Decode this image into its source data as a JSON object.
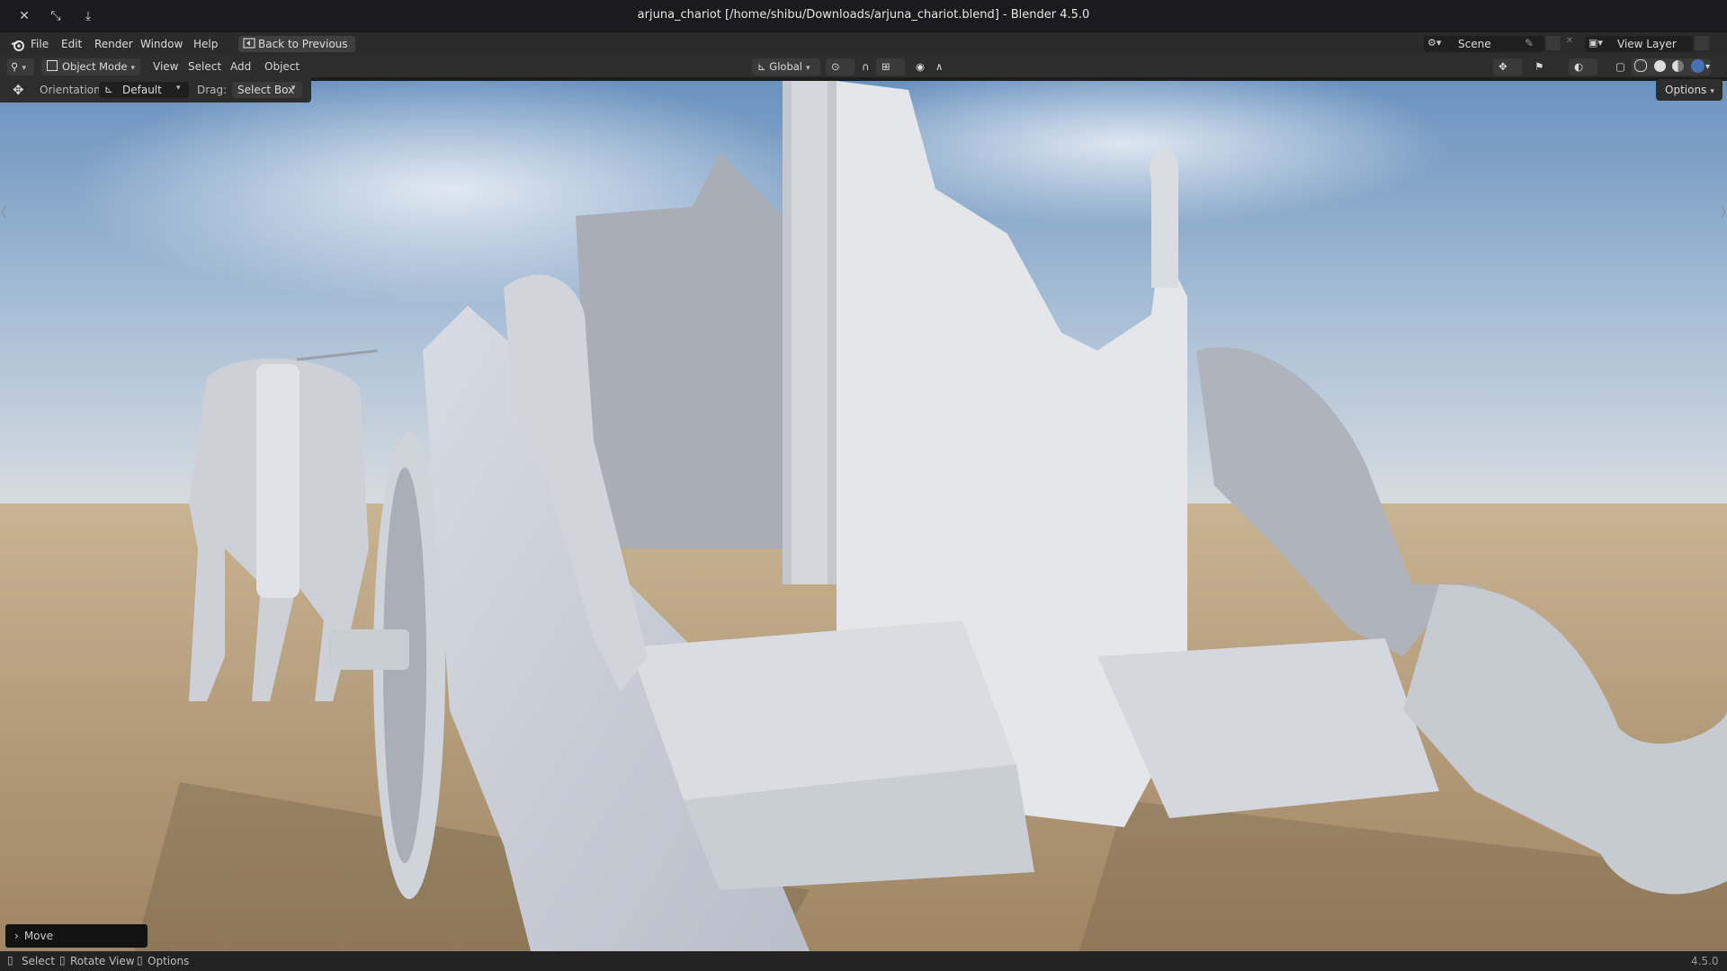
{
  "window": {
    "title": "arjuna_chariot [/home/shibu/Downloads/arjuna_chariot.blend] - Blender 4.5.0"
  },
  "menubar": {
    "items": [
      "File",
      "Edit",
      "Render",
      "Window",
      "Help"
    ],
    "back_button": "Back to Previous",
    "scene_label": "Scene",
    "view_layer_label": "View Layer"
  },
  "header": {
    "mode": "Object Mode",
    "menus": [
      "View",
      "Select",
      "Add",
      "Object"
    ],
    "transform_orientation": "Global"
  },
  "tool_settings": {
    "orientation_label": "Orientation:",
    "orientation_value": "Default",
    "drag_label": "Drag:",
    "drag_value": "Select Box",
    "options_button": "Options"
  },
  "operator_panel": {
    "label": "Move"
  },
  "statusbar": {
    "select": "Select",
    "rotate": "Rotate View",
    "options": "Options",
    "version": "4.5.0"
  },
  "colors": {
    "accent": "#4772b3",
    "ui_dark": "#2d2d2d",
    "sky_top": "#6f95bf",
    "ground": "#b59a6f"
  }
}
